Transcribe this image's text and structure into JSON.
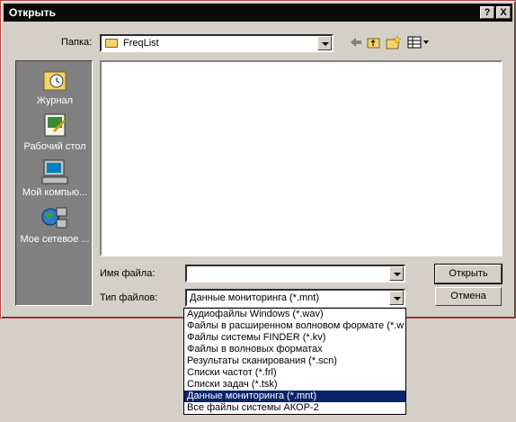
{
  "window": {
    "title": "Открыть"
  },
  "titlebar_buttons": {
    "help": "?",
    "close": "X"
  },
  "folder": {
    "label": "Папка:",
    "value": "FreqList"
  },
  "places": [
    {
      "label": "Журнал"
    },
    {
      "label": "Рабочий стол"
    },
    {
      "label": "Мой компью..."
    },
    {
      "label": "Мое сетевое ..."
    }
  ],
  "filename": {
    "label": "Имя файла:",
    "value": ""
  },
  "filetype": {
    "label": "Тип файлов:",
    "value": "Данные мониторинга (*.mnt)"
  },
  "buttons": {
    "open": "Открыть",
    "cancel": "Отмена"
  },
  "filetype_options": [
    "Аудиофайлы Windows (*.wav)",
    "Файлы в расширенном волновом формате (*.w",
    "Файлы системы FINDER (*.kv)",
    "Файлы в волновых форматах",
    "Результаты сканирования (*.scn)",
    "Списки частот (*.frl)",
    "Списки задач (*.tsk)",
    "Данные мониторинга (*.mnt)",
    "Все файлы системы АКОР-2"
  ],
  "selected_option_index": 7,
  "colors": {
    "selection": "#0a246a",
    "face": "#d4d0c8",
    "titlebar": "#0a0a0a"
  }
}
